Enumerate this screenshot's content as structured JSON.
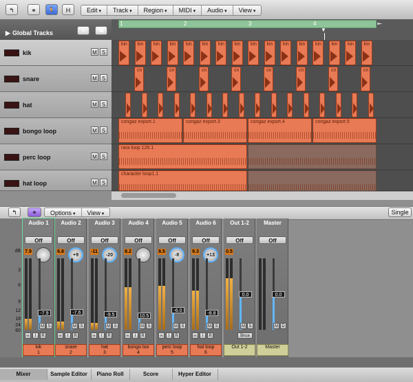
{
  "toolbar": {
    "btn_h": "H",
    "menus": [
      "Edit",
      "Track",
      "Region",
      "MIDI",
      "Audio",
      "View"
    ]
  },
  "arrange": {
    "global_tracks": "Global Tracks",
    "ruler": [
      "1",
      "2",
      "3",
      "4"
    ],
    "tracks": [
      {
        "name": "kik",
        "m": "M",
        "s": "S"
      },
      {
        "name": "snare",
        "m": "M",
        "s": "S"
      },
      {
        "name": "hat",
        "m": "M",
        "s": "S"
      },
      {
        "name": "bongo loop",
        "m": "M",
        "s": "S"
      },
      {
        "name": "perc loop",
        "m": "M",
        "s": "S"
      },
      {
        "name": "hat loop",
        "m": "M",
        "s": "S"
      }
    ],
    "kik_label": "kin",
    "snare_label": "cn",
    "bongo_regions": [
      "congaz export.1",
      "congaz export.3",
      "congaz export.4",
      "congaz export.5"
    ],
    "perc_region": "rara loop 128.1",
    "hatloop_region": "character loop1.1"
  },
  "mixer_bar": {
    "options": "Options",
    "view": "View",
    "single": "Single"
  },
  "mixer": {
    "scale": [
      "dB",
      "3",
      "6",
      "9",
      "12",
      "18",
      "24",
      "60"
    ],
    "strips": [
      {
        "name": "Audio 1",
        "off": "Off",
        "peak": "7.9",
        "pan": "",
        "vol": "-7.9",
        "label": "kik",
        "num": "1",
        "m": "M",
        "s": "S",
        "i": "I",
        "r": "R",
        "level": 0.15,
        "fader": 0.24
      },
      {
        "name": "Audio 2",
        "off": "Off",
        "peak": "6.8",
        "pan": "+9",
        "vol": "-7.6",
        "label": "snare",
        "num": "2",
        "m": "M",
        "s": "S",
        "i": "I",
        "r": "R",
        "level": 0.12,
        "fader": 0.25
      },
      {
        "name": "Audio 3",
        "off": "Off",
        "peak": "-11",
        "pan": "-20",
        "vol": "-9.5",
        "label": "hat",
        "num": "3",
        "m": "M",
        "s": "S",
        "i": "I",
        "r": "R",
        "level": 0.1,
        "fader": 0.22
      },
      {
        "name": "Audio 4",
        "off": "Off",
        "peak": "8.2",
        "pan": "",
        "vol": "10.5",
        "label": "bongo loo",
        "num": "4",
        "m": "M",
        "s": "S",
        "i": "I",
        "r": "R",
        "level": 0.6,
        "fader": 0.2
      },
      {
        "name": "Audio 5",
        "off": "Off",
        "peak": "8.5",
        "pan": "-8",
        "vol": "-6.0",
        "label": "perc loop",
        "num": "5",
        "m": "M",
        "s": "S",
        "i": "I",
        "r": "R",
        "level": 0.62,
        "fader": 0.28
      },
      {
        "name": "Audio 6",
        "off": "Off",
        "peak": "9.3",
        "pan": "+13",
        "vol": "-8.8",
        "label": "hat loop",
        "num": "6",
        "m": "M",
        "s": "S",
        "i": "I",
        "r": "R",
        "level": 0.55,
        "fader": 0.24
      },
      {
        "name": "Out 1-2",
        "off": "Off",
        "peak": "0.5",
        "pan": "",
        "vol": "0.0",
        "label": "Out 1-2",
        "num": "",
        "m": "M",
        "s": "S",
        "i": "",
        "r": "",
        "bnce": "Bnce",
        "level": 0.72,
        "fader": 0.5
      },
      {
        "name": "Master",
        "off": "Off",
        "peak": "",
        "pan": "",
        "vol": "0.0",
        "label": "Master",
        "num": "",
        "m": "M",
        "s": "D",
        "i": "",
        "r": "",
        "level": 0,
        "fader": 0.5
      }
    ]
  },
  "tabs": [
    "Mixer",
    "Sample Editor",
    "Piano Roll",
    "Score",
    "Hyper Editor"
  ]
}
